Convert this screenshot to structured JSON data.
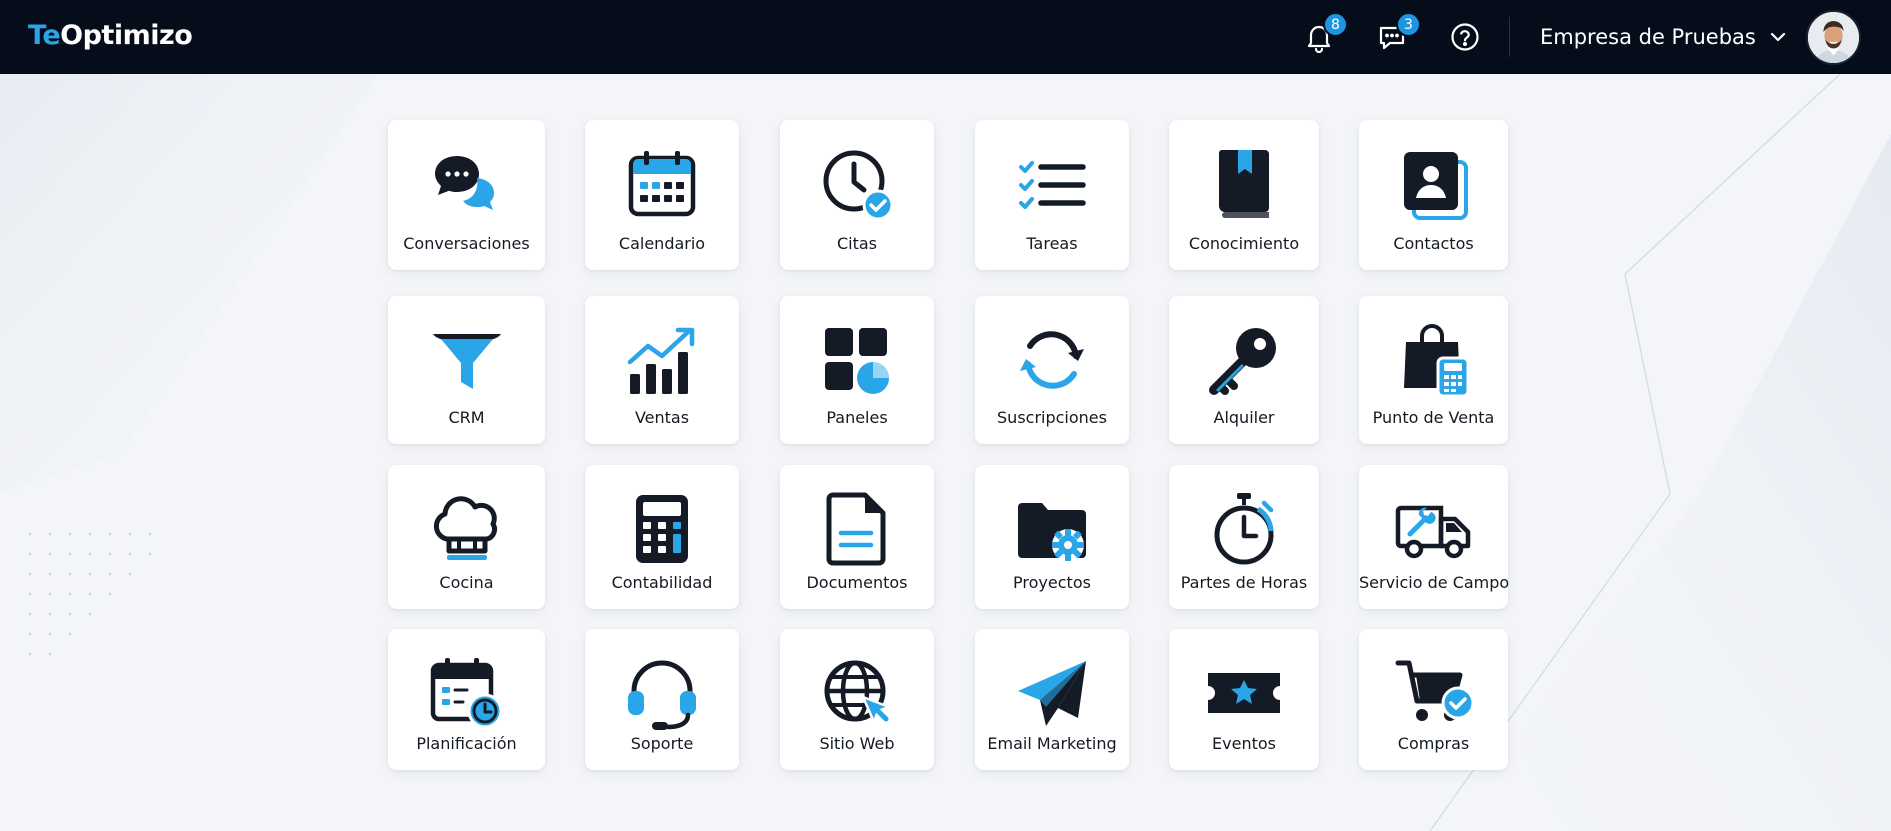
{
  "header": {
    "logo": {
      "part1": "Te",
      "part2": "Optimizo"
    },
    "notifications": {
      "icon": "bell-icon",
      "count": "8"
    },
    "messages": {
      "icon": "chat-icon",
      "count": "3"
    },
    "help": {
      "icon": "help-icon"
    },
    "company": {
      "name": "Empresa de Pruebas",
      "icon": "chevron-down-icon"
    },
    "avatar": {
      "icon": "user-avatar"
    }
  },
  "colors": {
    "header_bg": "#050d1a",
    "accent": "#2aa5e8",
    "badge": "#1e95e0",
    "icon_dark": "#141b26",
    "page_bg": "#f3f5f8"
  },
  "apps": [
    {
      "label": "Conversaciones",
      "icon": "chat-bubbles-icon"
    },
    {
      "label": "Calendario",
      "icon": "calendar-icon"
    },
    {
      "label": "Citas",
      "icon": "clock-check-icon"
    },
    {
      "label": "Tareas",
      "icon": "checklist-icon"
    },
    {
      "label": "Conocimiento",
      "icon": "book-icon"
    },
    {
      "label": "Contactos",
      "icon": "contact-card-icon"
    },
    {
      "label": "CRM",
      "icon": "funnel-icon"
    },
    {
      "label": "Ventas",
      "icon": "bar-chart-up-icon"
    },
    {
      "label": "Paneles",
      "icon": "dashboard-icon"
    },
    {
      "label": "Suscripciones",
      "icon": "refresh-icon"
    },
    {
      "label": "Alquiler",
      "icon": "key-icon"
    },
    {
      "label": "Punto de Venta",
      "icon": "shopping-bag-icon"
    },
    {
      "label": "Cocina",
      "icon": "chef-hat-icon"
    },
    {
      "label": "Contabilidad",
      "icon": "calculator-icon"
    },
    {
      "label": "Documentos",
      "icon": "document-icon"
    },
    {
      "label": "Proyectos",
      "icon": "folder-gear-icon"
    },
    {
      "label": "Partes de Horas",
      "icon": "stopwatch-icon"
    },
    {
      "label": "Servicio de Campo",
      "icon": "service-truck-icon"
    },
    {
      "label": "Planificación",
      "icon": "calendar-clock-icon"
    },
    {
      "label": "Soporte",
      "icon": "headset-icon"
    },
    {
      "label": "Sitio Web",
      "icon": "globe-cursor-icon"
    },
    {
      "label": "Email Marketing",
      "icon": "paper-plane-icon"
    },
    {
      "label": "Eventos",
      "icon": "ticket-icon"
    },
    {
      "label": "Compras",
      "icon": "cart-check-icon"
    }
  ]
}
